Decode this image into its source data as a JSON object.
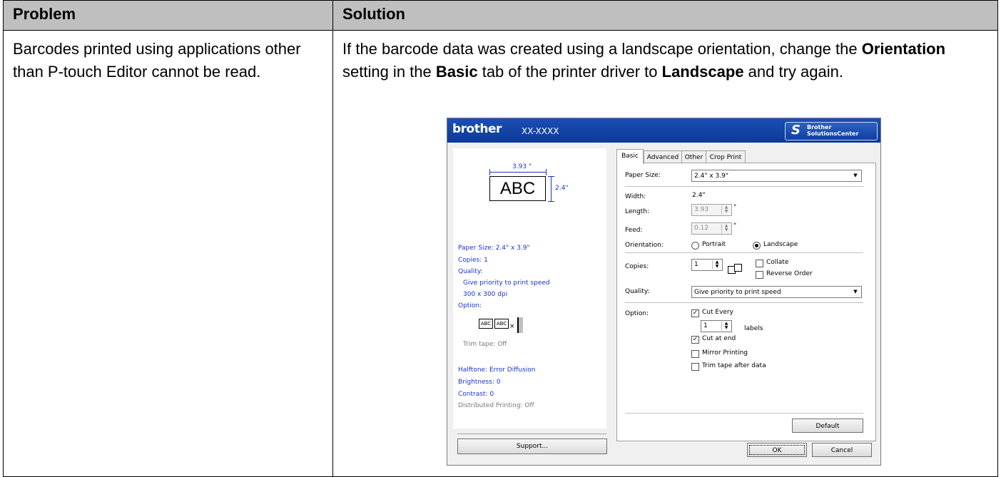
{
  "table": {
    "col_problem": "Problem",
    "col_solution": "Solution",
    "problem_text": "Barcodes printed using applications other than P-touch Editor cannot be read.",
    "solution_parts": {
      "p1": "If the barcode data was created using a landscape orientation, change the ",
      "b1": "Orientation",
      "p2": " setting in the ",
      "b2": "Basic",
      "p3": " tab of the printer driver to ",
      "b3": "Landscape",
      "p4": " and try again."
    }
  },
  "dialog": {
    "brand": "brother",
    "model": "XX-XXXX",
    "solutions_center_1": "Brother",
    "solutions_center_2": "SolutionsCenter",
    "preview": {
      "width_label": "3.93 \"",
      "height_label": "2.4\"",
      "sample_text": "ABC",
      "paper_size": "Paper Size: 2.4\" x 3.9\"",
      "copies": "Copies: 1",
      "quality": "Quality:",
      "quality_v1": "Give priority to print speed",
      "quality_v2": "300 x 300 dpi",
      "option": "Option:",
      "trim_tape": "Trim tape: Off",
      "halftone": "Halftone: Error Diffusion",
      "brightness": "Brightness:  0",
      "contrast": "Contrast:  0",
      "distributed": "Distributed Printing: Off"
    },
    "support_button": "Support...",
    "tabs": [
      "Basic",
      "Advanced",
      "Other",
      "Crop Print"
    ],
    "basic": {
      "paper_size_label": "Paper Size:",
      "paper_size_value": "2.4\" x 3.9\"",
      "width_label": "Width:",
      "width_value": "2.4\"",
      "length_label": "Length:",
      "length_value": "3.93",
      "feed_label": "Feed:",
      "feed_value": "0.12",
      "unit": "\"",
      "orientation_label": "Orientation:",
      "portrait": "Portrait",
      "landscape": "Landscape",
      "copies_label": "Copies:",
      "copies_value": "1",
      "collate": "Collate",
      "reverse_order": "Reverse Order",
      "quality_label": "Quality:",
      "quality_value": "Give priority to print speed",
      "option_label": "Option:",
      "cut_every": "Cut Every",
      "cut_every_value": "1",
      "labels": "labels",
      "cut_at_end": "Cut at end",
      "mirror_printing": "Mirror Printing",
      "trim_tape_after": "Trim tape after data",
      "default_button": "Default"
    },
    "ok_button": "OK",
    "cancel_button": "Cancel"
  }
}
